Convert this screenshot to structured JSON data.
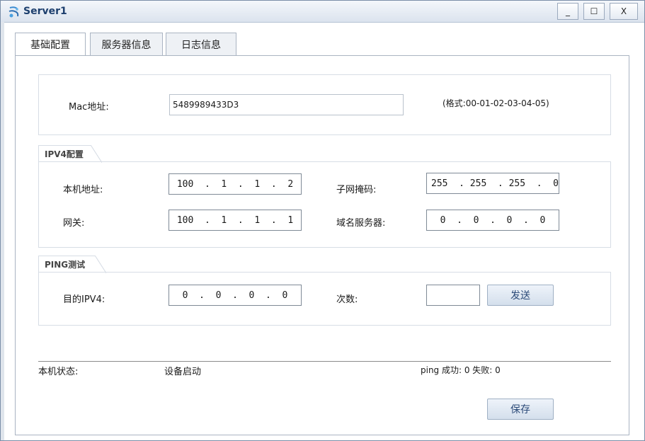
{
  "window": {
    "title": "Server1",
    "minimize": "_",
    "maximize": "☐",
    "close": "X"
  },
  "tabs": [
    {
      "label": "基础配置"
    },
    {
      "label": "服务器信息"
    },
    {
      "label": "日志信息"
    }
  ],
  "mac": {
    "label": "Mac地址:",
    "value": "5489989433D3",
    "format_hint": "(格式:00-01-02-03-04-05)"
  },
  "ipv4": {
    "group_title": "IPV4配置",
    "local_label": "本机地址:",
    "local_value": "100  .  1  .  1  .  2",
    "mask_label": "子网掩码:",
    "mask_value": "255  . 255  . 255  .  0",
    "gateway_label": "网关:",
    "gateway_value": "100  .  1  .  1  .  1",
    "dns_label": "域名服务器:",
    "dns_value": "0  .  0  .  0  .  0"
  },
  "ping": {
    "group_title": "PING测试",
    "dest_label": "目的IPV4:",
    "dest_value": "0  .  0  .  0  .  0",
    "count_label": "次数:",
    "count_value": "",
    "send_button": "发送"
  },
  "status": {
    "label": "本机状态:",
    "value": "设备启动",
    "ping_result": "ping 成功: 0 失败: 0"
  },
  "save_button": "保存",
  "colors": {
    "accent": "#1d3f6e",
    "button_text": "#2b4a78",
    "border": "#aab4c2"
  },
  "icons": {
    "app": "server-app-icon"
  }
}
